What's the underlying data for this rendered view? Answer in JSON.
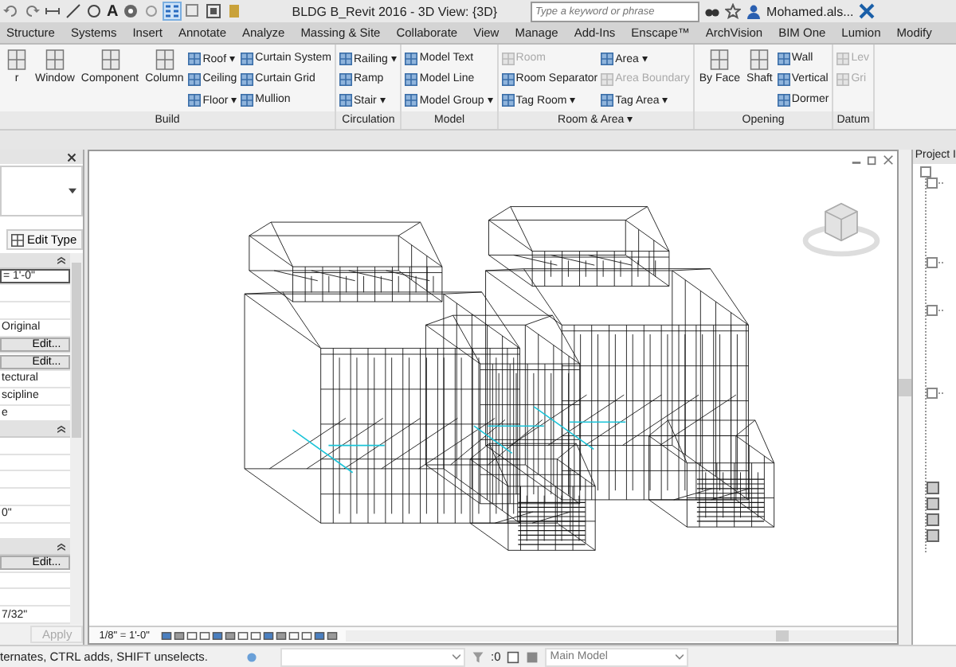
{
  "title_bar": {
    "text_tool_glyph": "A",
    "title": "BLDG B_Revit 2016 - 3D View: {3D}",
    "search": {
      "placeholder": "Type a keyword or phrase"
    },
    "user": "Mohamed.als..."
  },
  "ribbon_tabs": [
    {
      "label": "Structure",
      "selected": false
    },
    {
      "label": "Systems",
      "selected": false
    },
    {
      "label": "Insert",
      "selected": false
    },
    {
      "label": "Annotate",
      "selected": false
    },
    {
      "label": "Analyze",
      "selected": false
    },
    {
      "label": "Massing & Site",
      "selected": false
    },
    {
      "label": "Collaborate",
      "selected": false
    },
    {
      "label": "View",
      "selected": false
    },
    {
      "label": "Manage",
      "selected": false
    },
    {
      "label": "Add-Ins",
      "selected": false
    },
    {
      "label": "Enscape™",
      "selected": false
    },
    {
      "label": "ArchVision",
      "selected": false
    },
    {
      "label": "BIM One",
      "selected": false
    },
    {
      "label": "Lumion",
      "selected": false
    },
    {
      "label": "Modify",
      "selected": false
    }
  ],
  "ribbon_panels": [
    {
      "label": "Build",
      "columns": [
        {
          "kind": "large",
          "tools": [
            {
              "label": "r",
              "disabled": false
            }
          ]
        },
        {
          "kind": "large",
          "tools": [
            {
              "label": "Window",
              "disabled": false
            }
          ]
        },
        {
          "kind": "large",
          "tools": [
            {
              "label": "Component",
              "disabled": false
            }
          ]
        },
        {
          "kind": "large",
          "tools": [
            {
              "label": "Column",
              "disabled": false
            }
          ]
        },
        {
          "kind": "small",
          "tools": [
            {
              "label": "Roof ▾",
              "disabled": false
            },
            {
              "label": "Ceiling",
              "disabled": false
            },
            {
              "label": "Floor ▾",
              "disabled": false
            }
          ]
        },
        {
          "kind": "small",
          "tools": [
            {
              "label": "Curtain System",
              "disabled": false
            },
            {
              "label": "Curtain Grid",
              "disabled": false
            },
            {
              "label": "Mullion",
              "disabled": false
            }
          ]
        }
      ]
    },
    {
      "label": "Circulation",
      "columns": [
        {
          "kind": "small",
          "tools": [
            {
              "label": "Railing ▾",
              "disabled": false
            },
            {
              "label": "Ramp",
              "disabled": false
            },
            {
              "label": "Stair ▾",
              "disabled": false
            }
          ]
        }
      ]
    },
    {
      "label": "Model",
      "columns": [
        {
          "kind": "small",
          "tools": [
            {
              "label": "Model Text",
              "disabled": false
            },
            {
              "label": "Model Line",
              "disabled": false
            },
            {
              "label": "Model Group ▾",
              "disabled": false
            }
          ]
        }
      ]
    },
    {
      "label": "Room & Area ▾",
      "columns": [
        {
          "kind": "small",
          "tools": [
            {
              "label": "Room",
              "disabled": true
            },
            {
              "label": "Room Separator",
              "disabled": false
            },
            {
              "label": "Tag Room ▾",
              "disabled": false
            }
          ]
        },
        {
          "kind": "small",
          "tools": [
            {
              "label": "Area ▾",
              "disabled": false
            },
            {
              "label": "Area Boundary",
              "disabled": true
            },
            {
              "label": "Tag Area ▾",
              "disabled": false
            }
          ]
        }
      ]
    },
    {
      "label": "Opening",
      "columns": [
        {
          "kind": "large",
          "tools": [
            {
              "label": "By Face",
              "disabled": false
            }
          ]
        },
        {
          "kind": "large",
          "tools": [
            {
              "label": "Shaft",
              "disabled": false
            }
          ]
        },
        {
          "kind": "small",
          "tools": [
            {
              "label": "Wall",
              "disabled": false
            },
            {
              "label": "Vertical",
              "disabled": false
            },
            {
              "label": "Dormer",
              "disabled": false
            }
          ]
        }
      ]
    },
    {
      "label": "Datum",
      "columns": [
        {
          "kind": "small",
          "tools": [
            {
              "label": "Lev",
              "disabled": true
            },
            {
              "label": "Gri",
              "disabled": true
            }
          ]
        }
      ]
    }
  ],
  "properties": {
    "edit_type": "Edit Type",
    "rows": [
      {
        "kind": "section"
      },
      {
        "kind": "field",
        "value": "= 1'-0\""
      },
      {
        "kind": "blank"
      },
      {
        "kind": "blank"
      },
      {
        "kind": "text",
        "value": "Original"
      },
      {
        "kind": "button",
        "value": "Edit..."
      },
      {
        "kind": "button",
        "value": "Edit..."
      },
      {
        "kind": "text",
        "value": "tectural"
      },
      {
        "kind": "text",
        "value": "scipline"
      },
      {
        "kind": "text",
        "value": "e"
      },
      {
        "kind": "section"
      },
      {
        "kind": "blank"
      },
      {
        "kind": "blank"
      },
      {
        "kind": "blank"
      },
      {
        "kind": "blank"
      },
      {
        "kind": "text",
        "value": "0\""
      },
      {
        "kind": "blank"
      },
      {
        "kind": "section"
      },
      {
        "kind": "button",
        "value": "Edit..."
      },
      {
        "kind": "blank"
      },
      {
        "kind": "blank"
      },
      {
        "kind": "text",
        "value": "7/32\""
      }
    ],
    "apply": "Apply"
  },
  "view": {
    "scale": "1/8\" = 1'-0\""
  },
  "project_browser": {
    "title": "Project I"
  },
  "status_bar": {
    "message": "ternates, CTRL adds, SHIFT unselects.",
    "selection_count": ":0",
    "model": "Main Model"
  }
}
